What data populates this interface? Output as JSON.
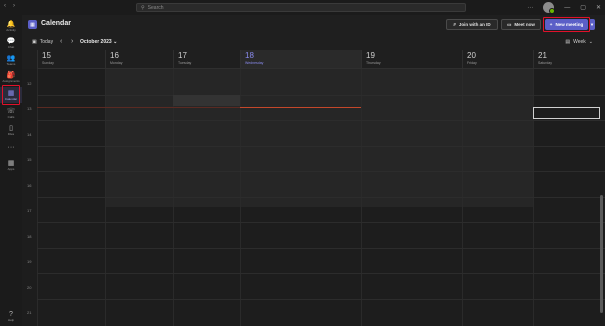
{
  "titlebar": {
    "back": "‹",
    "forward": "›",
    "search_placeholder": "Search",
    "more": "···",
    "minimize": "—",
    "maximize": "▢",
    "close": "✕"
  },
  "rail": [
    {
      "label": "Activity",
      "icon": "bell-icon",
      "glyph": "🔔"
    },
    {
      "label": "Chat",
      "icon": "chat-icon",
      "glyph": "💬"
    },
    {
      "label": "Teams",
      "icon": "teams-icon",
      "glyph": "👥"
    },
    {
      "label": "Assignments",
      "icon": "assignments-icon",
      "glyph": "🎒"
    },
    {
      "label": "Calendar",
      "icon": "calendar-icon",
      "glyph": "▦"
    },
    {
      "label": "Calls",
      "icon": "phone-icon",
      "glyph": "☏"
    },
    {
      "label": "Files",
      "icon": "file-icon",
      "glyph": "▯"
    },
    {
      "label": "",
      "icon": "more-icon",
      "glyph": "···"
    },
    {
      "label": "Apps",
      "icon": "apps-icon",
      "glyph": "▦"
    },
    {
      "label": "Help",
      "icon": "help-icon",
      "glyph": "?"
    }
  ],
  "header": {
    "title": "Calendar",
    "join_id": "Join with an ID",
    "meet_now": "Meet now",
    "new_meeting": "New meeting",
    "caret": "▾"
  },
  "toolbar": {
    "today": "Today",
    "month": "October 2023",
    "view": "Week"
  },
  "days": [
    {
      "num": "15",
      "name": "Sunday"
    },
    {
      "num": "16",
      "name": "Monday"
    },
    {
      "num": "17",
      "name": "Tuesday"
    },
    {
      "num": "18",
      "name": "Wednesday",
      "today": true
    },
    {
      "num": "19",
      "name": "Thursday"
    },
    {
      "num": "20",
      "name": "Friday"
    },
    {
      "num": "21",
      "name": "Saturday"
    }
  ],
  "hours": [
    "12",
    "13",
    "14",
    "15",
    "16",
    "17",
    "18",
    "19",
    "20",
    "21"
  ],
  "colors": {
    "accent": "#5b5fc7",
    "highlight": "#e0112b",
    "now_line": "#c4472a"
  }
}
